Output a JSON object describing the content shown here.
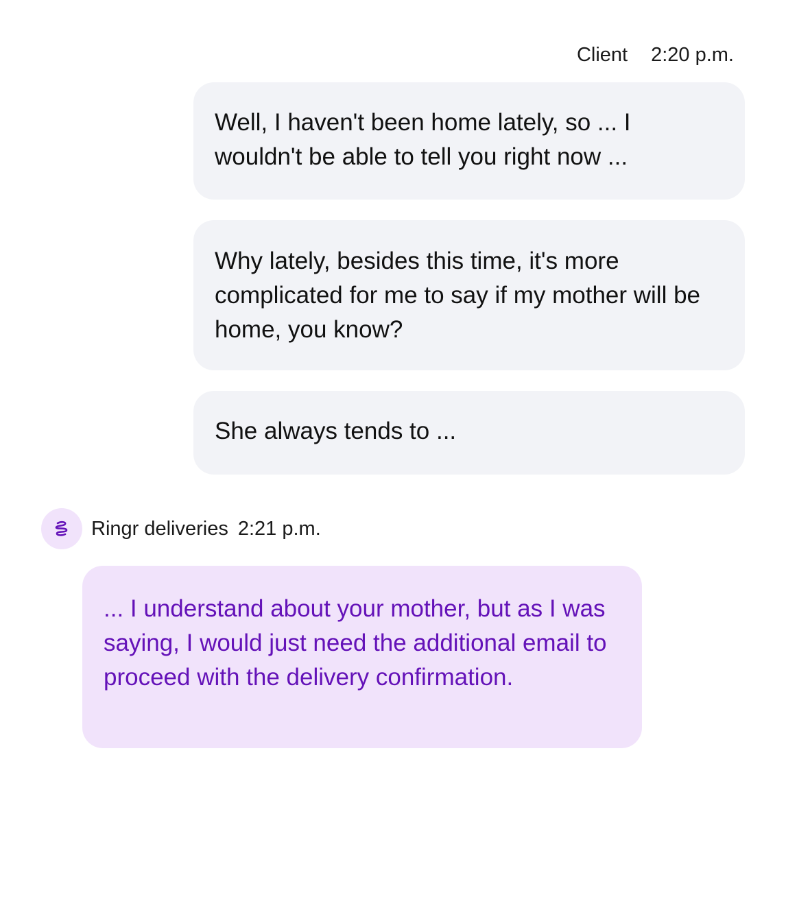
{
  "conversation": {
    "client_group": {
      "sender": "Client",
      "time": "2:20 p.m.",
      "messages": [
        {
          "text": "Well, I haven't been home lately, so ... I wouldn't be able to tell you right now ..."
        },
        {
          "text": "Why lately, besides this time, it's more complicated for me to say if my mother will be home, you know?"
        },
        {
          "text": "She always tends to ..."
        }
      ]
    },
    "agent_group": {
      "sender": "Ringr deliveries",
      "time": "2:21 p.m.",
      "avatar_icon": "ringr-logo-icon",
      "messages": [
        {
          "text": "... I understand about your mother, but as I was saying, I would just need the additional email to proceed with the delivery confirmation."
        }
      ]
    }
  },
  "colors": {
    "client_bubble": "#f2f3f7",
    "agent_bubble": "#f1e3fb",
    "agent_text": "#6412b8",
    "brand": "#6412b8"
  }
}
